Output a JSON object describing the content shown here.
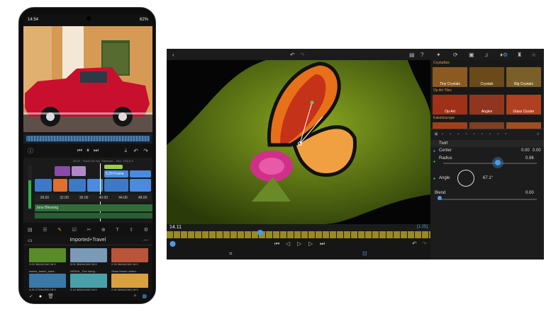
{
  "phone": {
    "status": {
      "time": "14:54",
      "battery": "62%"
    },
    "timeline_info": "45:15 · Travel (24 fps, Standard – Rec. 709) 6.8",
    "clip_label": "5.20 Frame",
    "ruler": [
      "28.00",
      "32.00",
      "36.00",
      "40.00",
      "44.00",
      "48.00"
    ],
    "audio_label": "Jona Blessing",
    "browser_title": "Imported+Travel",
    "thumbs": [
      {
        "label": "3.09 3840x2160 16:9",
        "color": "#5a8a2a"
      },
      {
        "label": "5.01 3840x2160 16:9",
        "color": "#7a9ab5"
      },
      {
        "label": "2.24 3840x2160 16:9",
        "color": "#b8553a"
      },
      {
        "label": "waves_beach_sand…",
        "color": "#3a78a8"
      },
      {
        "label": "AERIAL_Two loung…",
        "color": "#4aa0a8"
      },
      {
        "label": "Straw beach umbre…",
        "color": "#d8a040"
      }
    ],
    "thumb_sub": [
      "4.20 2720x1530 16:9",
      "3.14 3840x2160 16:9",
      "2.00 3840x2160 16:9"
    ]
  },
  "tablet": {
    "timecode": "14.11",
    "clip_badge": "[1.25]",
    "sections": [
      {
        "title": "Crystallize",
        "presets": [
          "Tiny Crystals",
          "Crystals",
          "Big Crystals"
        ],
        "colors": [
          "#8a5a20",
          "#6a4a18",
          "#7a6028"
        ]
      },
      {
        "title": "Op Art Tiles",
        "presets": [
          "Op-Art",
          "Angles",
          "Glass Cluster"
        ],
        "colors": [
          "#a03018",
          "#903520",
          "#b04020"
        ]
      },
      {
        "title": "Kaleidoscope",
        "presets": [
          "",
          "",
          ""
        ],
        "colors": [
          "#a04018",
          "#804020",
          "#a05020"
        ]
      }
    ],
    "effect": {
      "name": "Twirl",
      "center_label": "Center",
      "center_values": [
        "0.00",
        "0.00"
      ],
      "radius_label": "Radius",
      "radius_value": "0.96",
      "radius_fraction": 0.58,
      "angle_label": "Angle",
      "angle_value": "67.1°",
      "blend_label": "Blend",
      "blend_value": "0.00",
      "blend_fraction": 0.0
    }
  }
}
